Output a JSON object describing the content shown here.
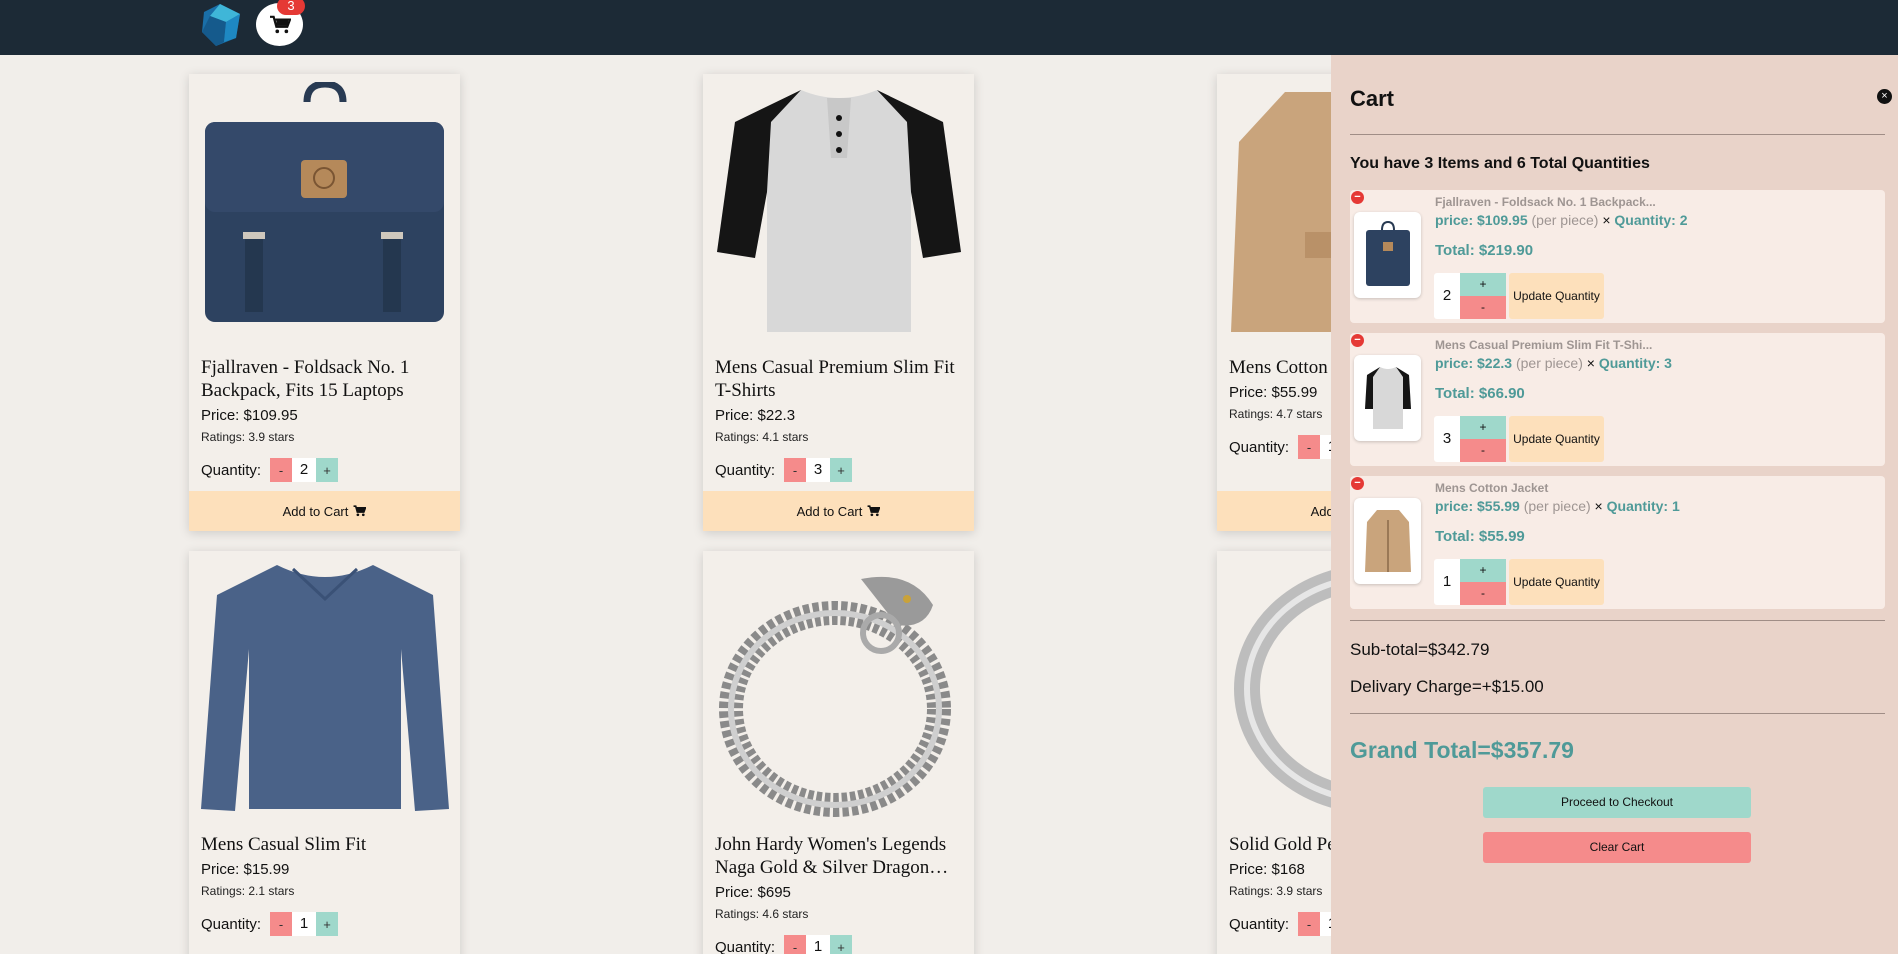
{
  "header": {
    "cart_count": "3"
  },
  "products": [
    {
      "title": "Fjallraven - Foldsack No. 1 Backpack, Fits 15 Laptops",
      "price": "Price: $109.95",
      "rating": "Ratings: 3.9 stars",
      "qty_label": "Quantity:",
      "qty": "2",
      "minus": "-",
      "plus": "+",
      "add_label": "Add to Cart"
    },
    {
      "title": "Mens Casual Premium Slim Fit T-Shirts",
      "price": "Price: $22.3",
      "rating": "Ratings: 4.1 stars",
      "qty_label": "Quantity:",
      "qty": "3",
      "minus": "-",
      "plus": "+",
      "add_label": "Add to Cart"
    },
    {
      "title": "Mens Cotton Jacket",
      "price": "Price: $55.99",
      "rating": "Ratings: 4.7 stars",
      "qty_label": "Quantity:",
      "qty": "1",
      "minus": "-",
      "plus": "+",
      "add_label": "Add to Cart"
    },
    {
      "title": "Mens Casual Slim Fit",
      "price": "Price: $15.99",
      "rating": "Ratings: 2.1 stars",
      "qty_label": "Quantity:",
      "qty": "1",
      "minus": "-",
      "plus": "+"
    },
    {
      "title": "John Hardy Women's Legends Naga Gold & Silver Dragon…",
      "price": "Price: $695",
      "rating": "Ratings: 4.6 stars",
      "qty_label": "Quantity:",
      "qty": "1",
      "minus": "-",
      "plus": "+"
    },
    {
      "title": "Solid Gold Petite Micropave",
      "price": "Price: $168",
      "rating": "Ratings: 3.9 stars",
      "qty_label": "Quantity:",
      "qty": "1",
      "minus": "-",
      "plus": "+"
    }
  ],
  "cart": {
    "title": "Cart",
    "close": "×",
    "summary": "You have 3 Items and 6 Total Quantities",
    "items": [
      {
        "remove": "−",
        "name": "Fjallraven - Foldsack No. 1 Backpack...",
        "price": "price: $109.95",
        "per_piece": "(per piece)",
        "times": "×",
        "quantity": "Quantity: 2",
        "total": "Total: $219.90",
        "qty": "2",
        "plus": "+",
        "minus": "-",
        "update": "Update Quantity"
      },
      {
        "remove": "−",
        "name": "Mens Casual Premium Slim Fit T-Shi...",
        "price": "price: $22.3",
        "per_piece": "(per piece)",
        "times": "×",
        "quantity": "Quantity: 3",
        "total": "Total: $66.90",
        "qty": "3",
        "plus": "+",
        "minus": "-",
        "update": "Update Quantity"
      },
      {
        "remove": "−",
        "name": "Mens Cotton Jacket",
        "price": "price: $55.99",
        "per_piece": "(per piece)",
        "times": "×",
        "quantity": "Quantity: 1",
        "total": "Total: $55.99",
        "qty": "1",
        "plus": "+",
        "minus": "-",
        "update": "Update Quantity"
      }
    ],
    "subtotal": "Sub-total=$342.79",
    "delivery": "Delivary Charge=+$15.00",
    "grand_total": "Grand Total=$357.79",
    "checkout": "Proceed to Checkout",
    "clear": "Clear Cart"
  },
  "colors": {
    "topbar": "#1c2a36",
    "panel": "#e9d3c9",
    "teal": "#4f9a98",
    "mint": "#9fd8cb",
    "salmon": "#f58b8b",
    "peach": "#fde0bb"
  }
}
